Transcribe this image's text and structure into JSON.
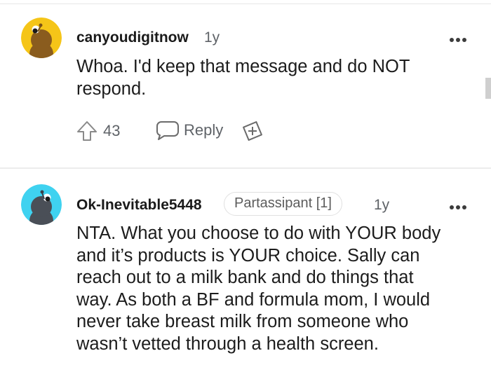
{
  "comments": [
    {
      "username": "canyoudigitnow",
      "age": "1y",
      "body": [
        "Whoa. I'd keep that message and do NOT",
        "respond."
      ],
      "votes": "43",
      "reply_label": "Reply",
      "avatar_color": "#f5c518"
    },
    {
      "username": "Ok-Inevitable5448",
      "flair": "Partassipant [1]",
      "age": "1y",
      "body": [
        "NTA. What you choose to do with YOUR body",
        "and it’s products is YOUR choice. Sally can",
        "reach out to a milk bank and do things that",
        "way. As both a BF and formula mom, I would",
        "never take breast milk from someone who",
        "wasn’t vetted through a health screen."
      ],
      "avatar_color": "#3fd2f0"
    }
  ],
  "icons": {
    "more": "more-options-icon",
    "upvote": "upvote-arrow-icon",
    "reply": "reply-bubble-icon",
    "award": "award-plus-icon"
  }
}
